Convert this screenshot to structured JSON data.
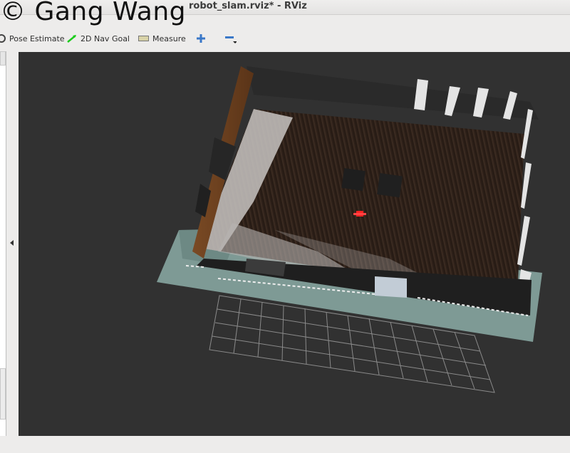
{
  "window": {
    "title": "robot_slam.rviz* - RViz"
  },
  "watermark": "© Gang Wang",
  "toolbar": {
    "pose_estimate": "Pose Estimate",
    "nav_goal": "2D Nav Goal",
    "measure": "Measure"
  },
  "icons": {
    "pose": "pose-estimate-icon",
    "nav": "nav-goal-icon",
    "measure": "measure-icon",
    "add": "plus-icon",
    "remove": "minus-icon",
    "collapse": "collapse-left-icon"
  },
  "colors": {
    "background": "#313131",
    "floor": "#2e2119",
    "wall": "#7e9a95",
    "robot": "#ff2222",
    "toolbar": "#edeceb",
    "grid": "#8a8a8a"
  }
}
